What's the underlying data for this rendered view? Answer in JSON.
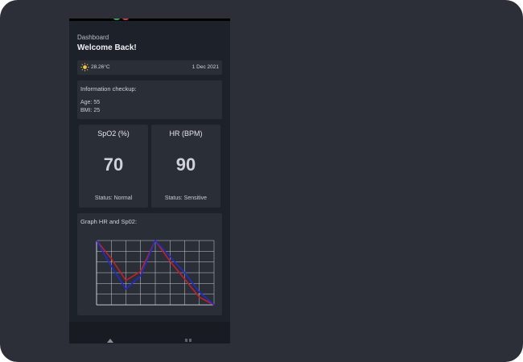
{
  "header": {
    "breadcrumb": "Dashboard",
    "greeting": "Welcome Back!"
  },
  "weather": {
    "icon": "sun-icon",
    "temperature": "28.26°C",
    "date": "1 Dec 2021"
  },
  "info": {
    "title": "Information checkup:",
    "age": "Age: 55",
    "bmi": "BMI: 25"
  },
  "metrics": [
    {
      "title": "SpO2 (%)",
      "value": "70",
      "status": "Status: Normal"
    },
    {
      "title": "HR (BPM)",
      "value": "90",
      "status": "Status: Sensitive"
    }
  ],
  "graph": {
    "title": "Graph HR and Sp02:"
  },
  "chart_data": {
    "type": "line",
    "x": [
      0,
      1,
      2,
      3,
      4,
      5,
      6,
      7,
      8
    ],
    "ylim": [
      0,
      100
    ],
    "grid": true,
    "series": [
      {
        "color": "#1f2bd6",
        "values": [
          100,
          60,
          25,
          45,
          100,
          75,
          50,
          20,
          0
        ]
      },
      {
        "color": "#c0202a",
        "values": [
          100,
          72,
          38,
          52,
          100,
          68,
          40,
          12,
          0
        ]
      }
    ]
  },
  "navbar": {
    "icons": [
      "home-icon",
      "grid-icon"
    ]
  },
  "colors": {
    "background": "#2c2e38",
    "phone": "#1d2129",
    "card": "#2a2e36"
  }
}
